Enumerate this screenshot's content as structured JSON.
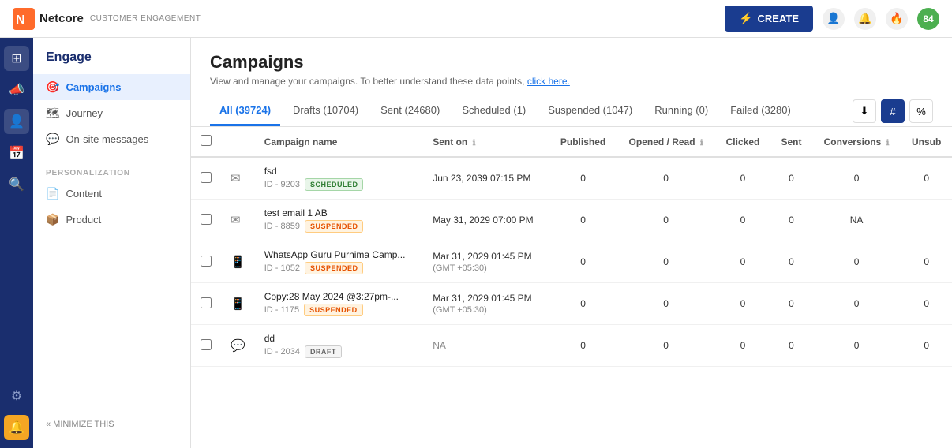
{
  "app": {
    "logo_text": "Netcore",
    "customer_engagement": "CUSTOMER ENGAGEMENT"
  },
  "topnav": {
    "create_label": "CREATE",
    "nav_icons": [
      "person",
      "bell",
      "fire",
      "84"
    ]
  },
  "sidebar": {
    "title": "Engage",
    "items": [
      {
        "label": "Campaigns",
        "icon": "🎯",
        "active": true
      },
      {
        "label": "Journey",
        "icon": "🗺"
      },
      {
        "label": "On-site messages",
        "icon": "💬"
      }
    ],
    "personalization_label": "PERSONALIZATION",
    "personalization_items": [
      {
        "label": "Content",
        "icon": "📄"
      },
      {
        "label": "Product",
        "icon": "📦"
      }
    ],
    "minimize_label": "« MINIMIZE THIS"
  },
  "page": {
    "title": "Campaigns",
    "subtitle": "View and manage your campaigns. To better understand these data points,",
    "subtitle_link": "click here.",
    "tabs": [
      {
        "label": "All (39724)",
        "active": true
      },
      {
        "label": "Drafts (10704)"
      },
      {
        "label": "Sent (24680)"
      },
      {
        "label": "Scheduled (1)"
      },
      {
        "label": "Suspended (1047)"
      },
      {
        "label": "Running (0)"
      },
      {
        "label": "Failed (3280)"
      }
    ]
  },
  "table": {
    "columns": [
      "",
      "",
      "Campaign name",
      "Sent on",
      "Published",
      "Opened / Read",
      "Clicked",
      "Sent",
      "Conversions",
      "Unsub"
    ],
    "rows": [
      {
        "id": "9203",
        "name": "fsd",
        "badge": "SCHEDULED",
        "badge_type": "scheduled",
        "channel": "email",
        "sent_on": "Jun 23, 2039 07:15 PM",
        "published": "0",
        "opened": "0",
        "clicked": "0",
        "sent": "0",
        "conversions": "0",
        "unsub": "0"
      },
      {
        "id": "8859",
        "name": "test email 1 AB",
        "badge": "SUSPENDED",
        "badge_type": "suspended",
        "channel": "email",
        "sent_on": "May 31, 2029 07:00 PM",
        "published": "0",
        "opened": "0",
        "clicked": "0",
        "sent": "0",
        "conversions": "NA",
        "unsub": ""
      },
      {
        "id": "1052",
        "name": "WhatsApp Guru Purnima Camp...",
        "badge": "SUSPENDED",
        "badge_type": "suspended",
        "channel": "whatsapp",
        "sent_on": "Mar 31, 2029 01:45 PM (GMT +05:30)",
        "published": "0",
        "opened": "0",
        "clicked": "0",
        "sent": "0",
        "conversions": "0",
        "unsub": "0"
      },
      {
        "id": "1175",
        "name": "Copy:28 May 2024 @3:27pm-...",
        "badge": "SUSPENDED",
        "badge_type": "suspended",
        "channel": "whatsapp",
        "sent_on": "Mar 31, 2029 01:45 PM (GMT +05:30)",
        "published": "0",
        "opened": "0",
        "clicked": "0",
        "sent": "0",
        "conversions": "0",
        "unsub": "0"
      },
      {
        "id": "2034",
        "name": "dd",
        "badge": "DRAFT",
        "badge_type": "draft",
        "channel": "chat",
        "sent_on": "NA",
        "published": "0",
        "opened": "0",
        "clicked": "0",
        "sent": "0",
        "conversions": "0",
        "unsub": "0"
      }
    ]
  }
}
